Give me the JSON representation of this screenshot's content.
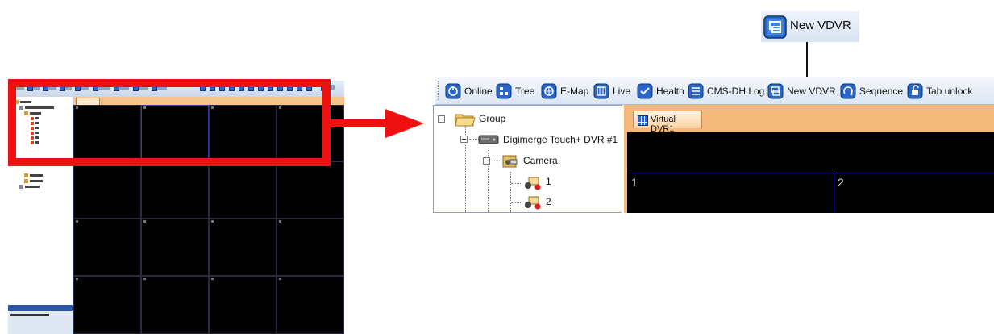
{
  "callout": {
    "label": "New VDVR",
    "icon": "new-vdvr-icon"
  },
  "toolbar": {
    "buttons": [
      {
        "label": "Online",
        "icon": "online-icon"
      },
      {
        "label": "Tree",
        "icon": "tree-icon"
      },
      {
        "label": "E-Map",
        "icon": "emap-icon"
      },
      {
        "label": "Live",
        "icon": "live-icon"
      },
      {
        "label": "Health",
        "icon": "health-icon"
      },
      {
        "label": "CMS-DH Log",
        "icon": "log-icon"
      },
      {
        "label": "New VDVR",
        "icon": "new-vdvr-icon"
      },
      {
        "label": "Sequence",
        "icon": "sequence-icon"
      },
      {
        "label": "Tab unlock",
        "icon": "tab-unlock-icon"
      }
    ]
  },
  "tree": {
    "group": "Group",
    "dvr": "Digimerge Touch+ DVR #1",
    "camera_folder": "Camera",
    "cameras": [
      "1",
      "2"
    ]
  },
  "viewer": {
    "tab_label": "Virtual DVR1",
    "cells": [
      "1",
      "2"
    ]
  },
  "colors": {
    "highlight_red": "#ee1111",
    "toolbar_blue": "#2a66c6",
    "tab_orange": "#f3b97a"
  }
}
